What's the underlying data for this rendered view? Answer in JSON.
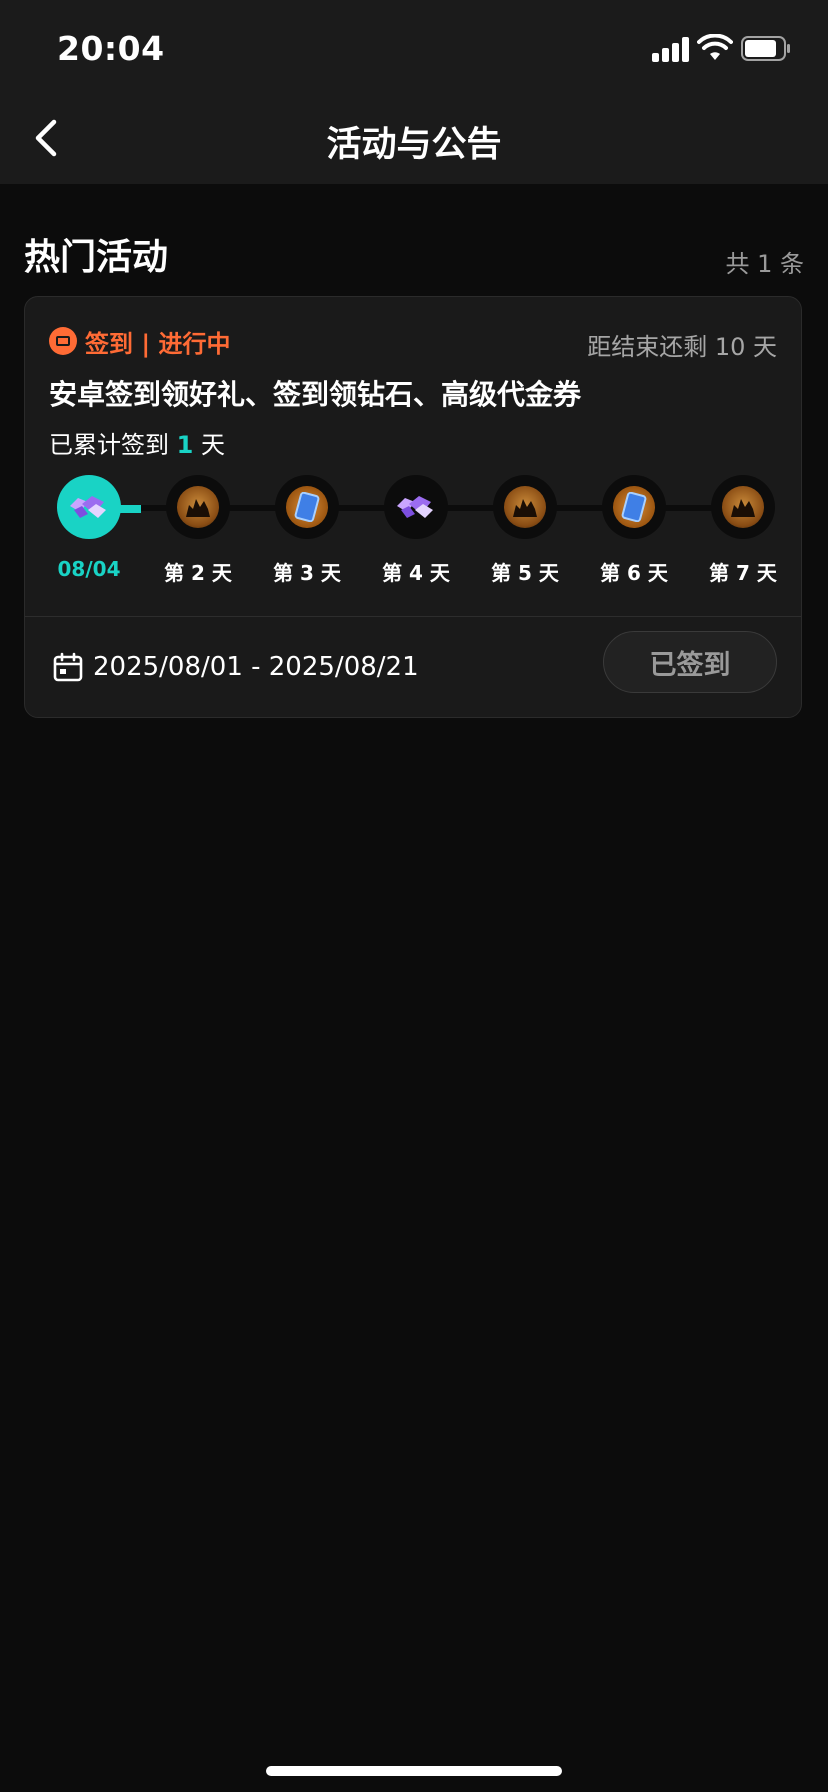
{
  "status_bar": {
    "time": "20:04"
  },
  "nav": {
    "title": "活动与公告"
  },
  "section": {
    "title": "热门活动",
    "count": "共 1 条"
  },
  "activity": {
    "tag": "签到 | 进行中",
    "remaining": "距结束还剩 10 天",
    "title": "安卓签到领好礼、签到领钻石、高级代金券",
    "progress_prefix": "已累计签到 ",
    "progress_days": "1",
    "progress_suffix": " 天",
    "days": [
      {
        "label": "08/04",
        "reward_icon": "diamond-icon",
        "active": true
      },
      {
        "label": "第 2 天",
        "reward_icon": "gift-pack-icon",
        "active": false
      },
      {
        "label": "第 3 天",
        "reward_icon": "voucher-card-icon",
        "active": false
      },
      {
        "label": "第 4 天",
        "reward_icon": "diamond-icon",
        "active": false
      },
      {
        "label": "第 5 天",
        "reward_icon": "gift-pack-icon",
        "active": false
      },
      {
        "label": "第 6 天",
        "reward_icon": "voucher-card-icon",
        "active": false
      },
      {
        "label": "第 7 天",
        "reward_icon": "gift-pack-icon",
        "active": false
      }
    ],
    "date_range": "2025/08/01 - 2025/08/21",
    "button_label": "已签到"
  },
  "colors": {
    "accent": "#19d3c5",
    "tag": "#ff6b35",
    "background": "#0c0c0c"
  }
}
